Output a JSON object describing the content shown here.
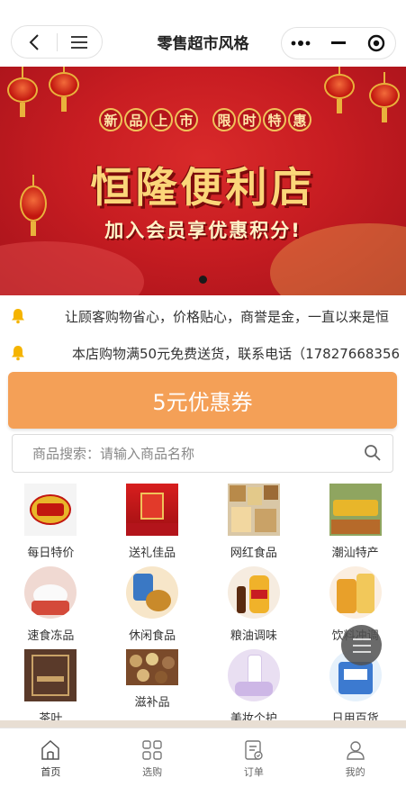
{
  "header": {
    "title": "零售超市风格",
    "back_icon": "chevron-left-icon",
    "menu_icon": "hamburger-icon",
    "more_icon": "more-dots-icon",
    "minimize_icon": "minimize-icon",
    "close_icon": "target-close-icon"
  },
  "banner": {
    "tags": [
      "新品上市",
      "限时特惠"
    ],
    "store_name": "恒隆便利店",
    "subtitle": "加入会员享优惠积分!",
    "active_dot": 1,
    "colors": {
      "background": "#c81d22",
      "gold": "#fbd679"
    }
  },
  "notices": [
    {
      "icon": "bell-icon",
      "text": "让顾客购物省心，价格贴心，商誉是金，一直以来是恒"
    },
    {
      "icon": "bell-icon",
      "text": "本店购物满50元免费送货，联系电话（17827668356"
    }
  ],
  "coupon": {
    "label": "5元优惠券",
    "color": "#f4a057"
  },
  "search": {
    "prefix": "商品搜索:",
    "placeholder": "商品搜索：请输入商品名称"
  },
  "categories": [
    {
      "label": "每日特价",
      "icon": "daily-special-icon"
    },
    {
      "label": "送礼佳品",
      "icon": "gift-box-icon"
    },
    {
      "label": "网红食品",
      "icon": "snack-collage-icon"
    },
    {
      "label": "潮汕特产",
      "icon": "local-specialty-icon"
    },
    {
      "label": "速食冻品",
      "icon": "frozen-food-icon"
    },
    {
      "label": "休闲食品",
      "icon": "leisure-snack-icon"
    },
    {
      "label": "粮油调味",
      "icon": "grain-oil-icon"
    },
    {
      "label": "饮料冲调",
      "icon": "beverage-icon"
    },
    {
      "label": "茶叶",
      "icon": "tea-box-icon"
    },
    {
      "label": "滋补品",
      "icon": "tonic-icon"
    },
    {
      "label": "美妆个护",
      "icon": "cosmetics-icon"
    },
    {
      "label": "日用百货",
      "icon": "daily-goods-icon"
    }
  ],
  "tabbar": [
    {
      "label": "首页",
      "icon": "home-icon",
      "active": true
    },
    {
      "label": "选购",
      "icon": "grid-icon",
      "active": false
    },
    {
      "label": "订单",
      "icon": "order-icon",
      "active": false
    },
    {
      "label": "我的",
      "icon": "user-icon",
      "active": false
    }
  ],
  "floating_button": {
    "icon": "hamburger-icon"
  }
}
